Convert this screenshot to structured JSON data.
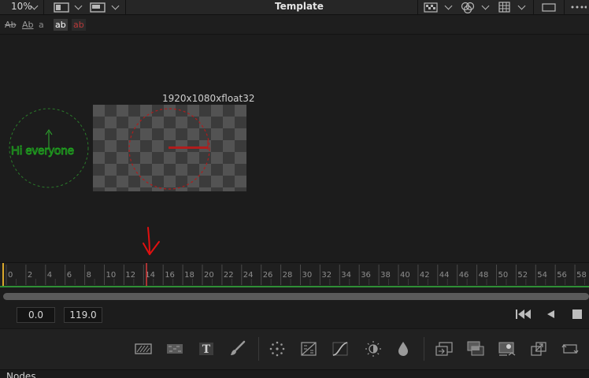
{
  "topbar": {
    "zoom_label": "10%",
    "title": "Template"
  },
  "subbar": {
    "text_buttons": [
      "Ab",
      "Ab",
      "a",
      "ab",
      "ab"
    ]
  },
  "viewer": {
    "resolution_label": "1920x1080xfloat32",
    "overlay_text": "Hi everyone"
  },
  "timeline": {
    "ticks": [
      "0",
      "2",
      "4",
      "6",
      "8",
      "10",
      "12",
      "14",
      "16",
      "18",
      "20",
      "22",
      "24",
      "26",
      "28",
      "30",
      "32",
      "34",
      "36",
      "38",
      "40",
      "42",
      "44",
      "46",
      "48",
      "50",
      "52",
      "54",
      "56",
      "58"
    ],
    "current_frame": 14.3
  },
  "range": {
    "start_value": "0.0",
    "end_value": "119.0"
  },
  "bottom": {
    "panel_label": "Nodes"
  },
  "colors": {
    "accent_green": "#2f8f36",
    "playhead_red": "#d93b3b",
    "annotation_red": "#e01010",
    "text_green": "#1fa51f",
    "mask_red": "#b01c1c"
  }
}
